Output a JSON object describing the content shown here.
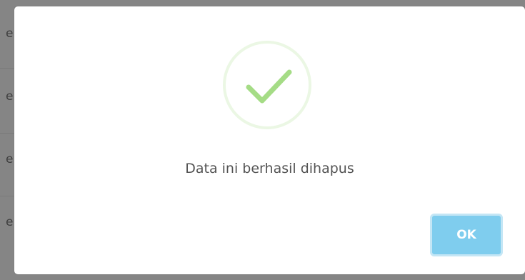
{
  "background": {
    "row_letters": [
      "e",
      "e",
      "e",
      "e"
    ]
  },
  "dialog": {
    "icon": "success-check-icon",
    "message": "Data ini berhasil dihapus",
    "confirm_label": "OK",
    "colors": {
      "check": "#a5dc86",
      "confirm_button": "#7fcdee",
      "message_text": "#545454"
    }
  }
}
